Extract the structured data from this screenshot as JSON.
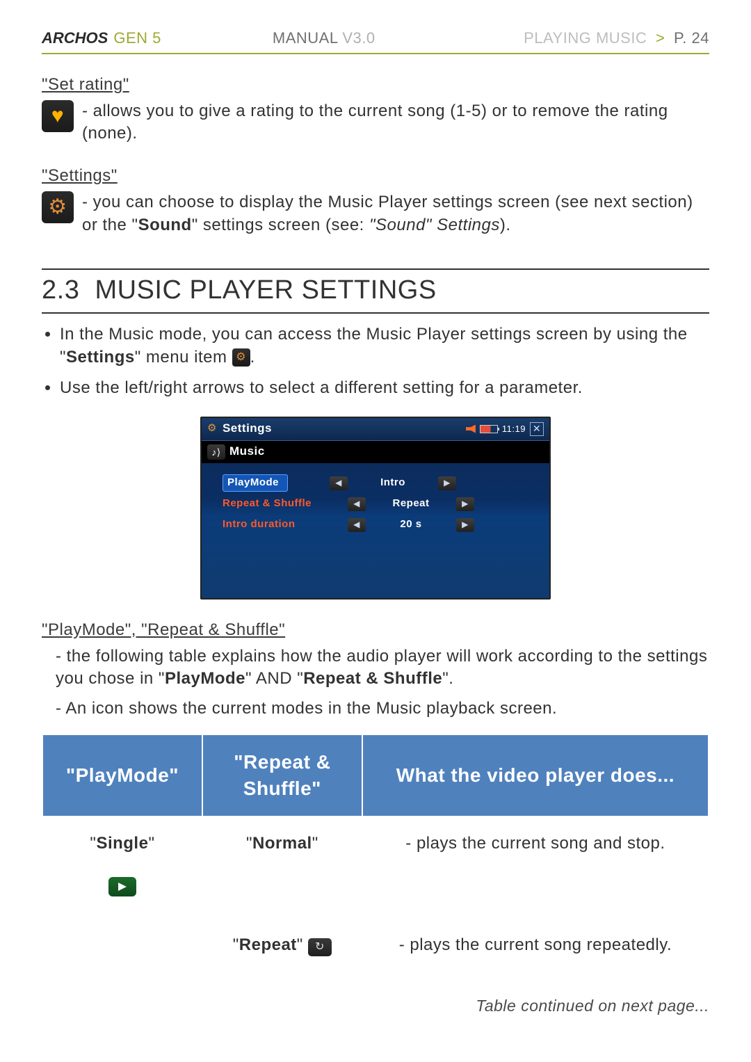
{
  "header": {
    "brand": "ARCHOS",
    "gen": "GEN 5",
    "manual_label": "MANUAL",
    "manual_ver": "V3.0",
    "crumb_section": "PLAYING MUSIC",
    "crumb_chev": ">",
    "crumb_page": "P. 24"
  },
  "set_rating": {
    "title": "\"Set rating\"",
    "text": "allows you to give a rating to the current song (1-5) or to remove the rating (none)."
  },
  "settings_msg": {
    "title": "\"Settings\"",
    "lead": "you can choose to display the Music Player settings screen (see next section) or the \"",
    "bold": "Sound",
    "mid": "\" settings screen (see: ",
    "ital": "\"Sound\" Settings",
    "tail": ")."
  },
  "section": {
    "number": "2.3",
    "title": "MUSIC PLAYER SETTINGS"
  },
  "bullets": {
    "b1a": "In the Music mode, you can access the Music Player settings screen by using the \"",
    "b1b": "Settings",
    "b1c": "\" menu item ",
    "b1d": ".",
    "b2": "Use the left/right arrows to select a different setting for a parameter."
  },
  "shot": {
    "title": "Settings",
    "time": "11:19",
    "breadcrumb": "Music",
    "rows": [
      {
        "name": "PlayMode",
        "value": "Intro",
        "selected": true
      },
      {
        "name": "Repeat & Shuffle",
        "value": "Repeat",
        "selected": false
      },
      {
        "name": "Intro duration",
        "value": "20 s",
        "selected": false
      }
    ]
  },
  "playmode_section": {
    "title": "\"PlayMode\", \"Repeat & Shuffle\"",
    "line1a": "the following table explains how the audio player will work according to the settings you chose in \"",
    "line1b": "PlayMode",
    "line1c": "\" AND \"",
    "line1d": "Repeat & Shuffle",
    "line1e": "\".",
    "line2": "An icon shows the current modes in the Music playback screen."
  },
  "table": {
    "head": {
      "c1": "\"PlayMode\"",
      "c2": "\"Repeat & Shuffle\"",
      "c3": "What the video player does..."
    },
    "r1": {
      "pm": "Single",
      "rs": "Normal",
      "desc": "- plays the current song and stop."
    },
    "r2": {
      "rs": "Repeat",
      "desc": "- plays the current song repeatedly."
    }
  },
  "continued": "Table continued on next page..."
}
